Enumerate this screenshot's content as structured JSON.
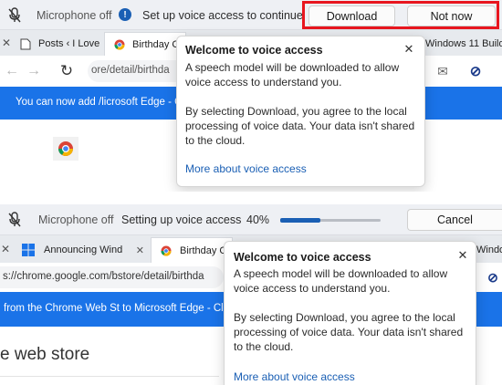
{
  "top": {
    "voice_bar": {
      "mic_status": "Microphone off",
      "message": "Set up voice access to continue",
      "download_label": "Download",
      "not_now_label": "Not now",
      "info_glyph": "!"
    },
    "tabs": [
      {
        "label": "Posts ‹ I Love"
      },
      {
        "label": "Birthday C"
      },
      {
        "label": "Windows 11 Build"
      }
    ],
    "url_text": "ore/detail/birthda",
    "banner_text": "You can now add /licrosoft Edge - Cl",
    "flyout": {
      "title": "Welcome to voice access",
      "para1": "A speech model will be downloaded to allow voice access to understand you.",
      "para2": "By selecting Download, you agree to the local processing of voice data. Your data isn't shared to the cloud.",
      "link": "More about voice access",
      "close_glyph": "✕"
    }
  },
  "bottom": {
    "voice_bar": {
      "mic_status": "Microphone off",
      "message": "Setting up voice access",
      "progress_text": "40%",
      "progress_value": 0.4,
      "cancel_label": "Cancel"
    },
    "tabs": [
      {
        "label": "Announcing Wind"
      },
      {
        "label": "Birthday C"
      },
      {
        "label": "Windo"
      }
    ],
    "url_text": "s://chrome.google.com/bstore/detail/birthda",
    "banner_text": "from the Chrome Web St to Microsoft Edge - Cl",
    "page_heading": "e web store",
    "flyout": {
      "title": "Welcome to voice access",
      "para1": "A speech model will be downloaded to allow voice access to understand you.",
      "para2": "By selecting Download, you agree to the local processing of voice data. Your data isn't shared to the cloud.",
      "link": "More about voice access",
      "close_glyph": "✕"
    }
  },
  "icons": {
    "close_tab": "✕",
    "back": "←",
    "forward": "→",
    "refresh": "↻",
    "mail": "✉",
    "block": "⊘"
  },
  "colors": {
    "accent": "#1a73e8",
    "highlight": "#e8161f",
    "progress": "#1a5fb4",
    "voice_bar_bg": "#eef0f4"
  }
}
